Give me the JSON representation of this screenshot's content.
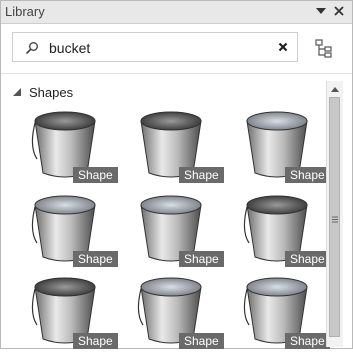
{
  "panel": {
    "title": "Library",
    "dropdown_icon": "chevron-down-icon",
    "close_icon": "close-icon"
  },
  "search": {
    "query": "bucket",
    "icon": "search-icon",
    "clear_icon": "clear-icon"
  },
  "view_toggle_icon": "hierarchy-icon",
  "section": {
    "label": "Shapes",
    "expanded": true
  },
  "items": [
    {
      "label": "Shape"
    },
    {
      "label": "Shape"
    },
    {
      "label": "Shape"
    },
    {
      "label": "Shape"
    },
    {
      "label": "Shape"
    },
    {
      "label": "Shape"
    },
    {
      "label": "Shape"
    },
    {
      "label": "Shape"
    },
    {
      "label": "Shape"
    }
  ]
}
